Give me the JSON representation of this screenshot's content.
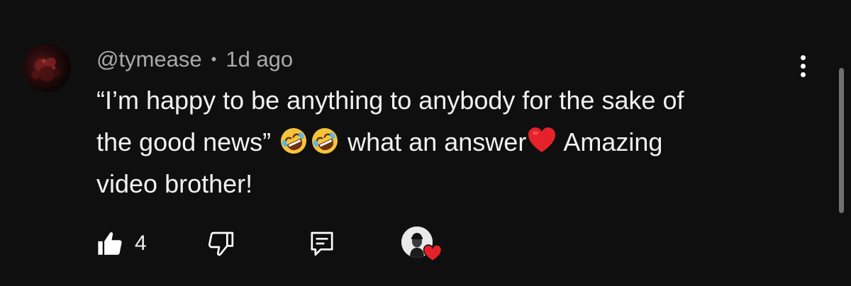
{
  "comment": {
    "author": "@tymease",
    "separator": "•",
    "timestamp": "1d ago",
    "text_line1": "“I’m happy to be anything to anybody for the sake of",
    "text_line2_a": "the good news” ",
    "text_line2_b": " what an answer",
    "text_line2_c": " Amazing",
    "text_line3": "video brother!",
    "emojis": [
      "rofl-emoji",
      "rofl-emoji",
      "red-heart-emoji"
    ]
  },
  "actions": {
    "like_count": "4",
    "icons": [
      "thumbs-up-icon",
      "thumbs-down-icon",
      "reply-icon",
      "creator-heart-icon"
    ]
  },
  "colors": {
    "background": "#0f0f0f",
    "text_primary": "#f1f1f1",
    "text_secondary": "#aaaaaa",
    "heart": "#e5222a"
  }
}
